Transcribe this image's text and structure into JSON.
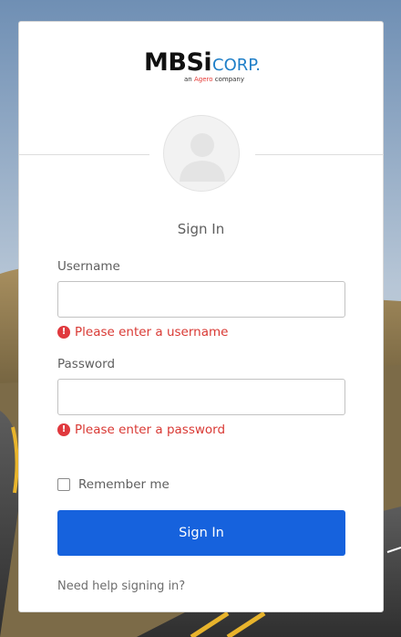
{
  "brand": {
    "name": "MBSi",
    "suffix": "CORP.",
    "tagline_prefix": "an",
    "tagline_brand": "Agero",
    "tagline_suffix": "company"
  },
  "form": {
    "title": "Sign In",
    "username": {
      "label": "Username",
      "value": "",
      "error": "Please enter a username"
    },
    "password": {
      "label": "Password",
      "value": "",
      "error": "Please enter a password"
    },
    "remember_me": {
      "label": "Remember me",
      "checked": false
    },
    "submit_label": "Sign In",
    "help_link": "Need help signing in?"
  },
  "colors": {
    "primary_button": "#1662dd",
    "error": "#d93934",
    "brand_corp": "#1f7fc8"
  },
  "icons": {
    "error": "exclamation-circle",
    "avatar": "user-silhouette"
  }
}
